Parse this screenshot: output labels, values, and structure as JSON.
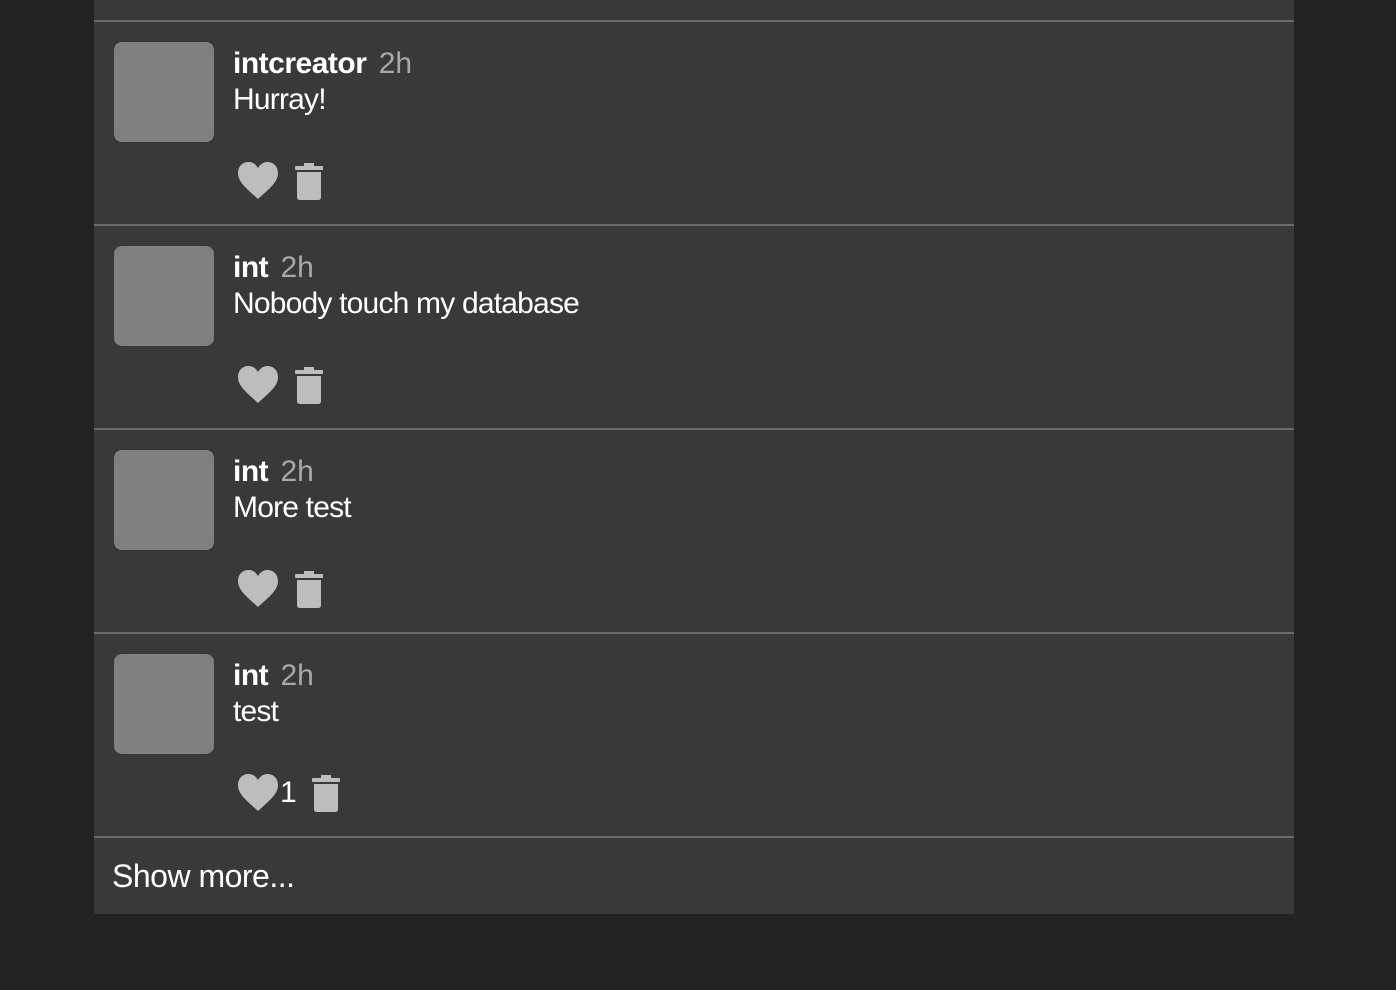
{
  "feed": {
    "posts": [
      {
        "author": "intcreator",
        "time": "2h",
        "text": "Hurray!",
        "likes": ""
      },
      {
        "author": "int",
        "time": "2h",
        "text": "Nobody touch my database",
        "likes": ""
      },
      {
        "author": "int",
        "time": "2h",
        "text": "More test",
        "likes": ""
      },
      {
        "author": "int",
        "time": "2h",
        "text": "test",
        "likes": "1"
      }
    ],
    "show_more_label": "Show more..."
  },
  "icons": {
    "like": "heart-icon",
    "delete": "trash-icon"
  },
  "colors": {
    "page_background": "#232323",
    "card_background": "#393939",
    "avatar_placeholder": "#808080",
    "icon": "#bdbdbd",
    "divider": "#6a6a6a",
    "timestamp": "#a9a9a9"
  }
}
